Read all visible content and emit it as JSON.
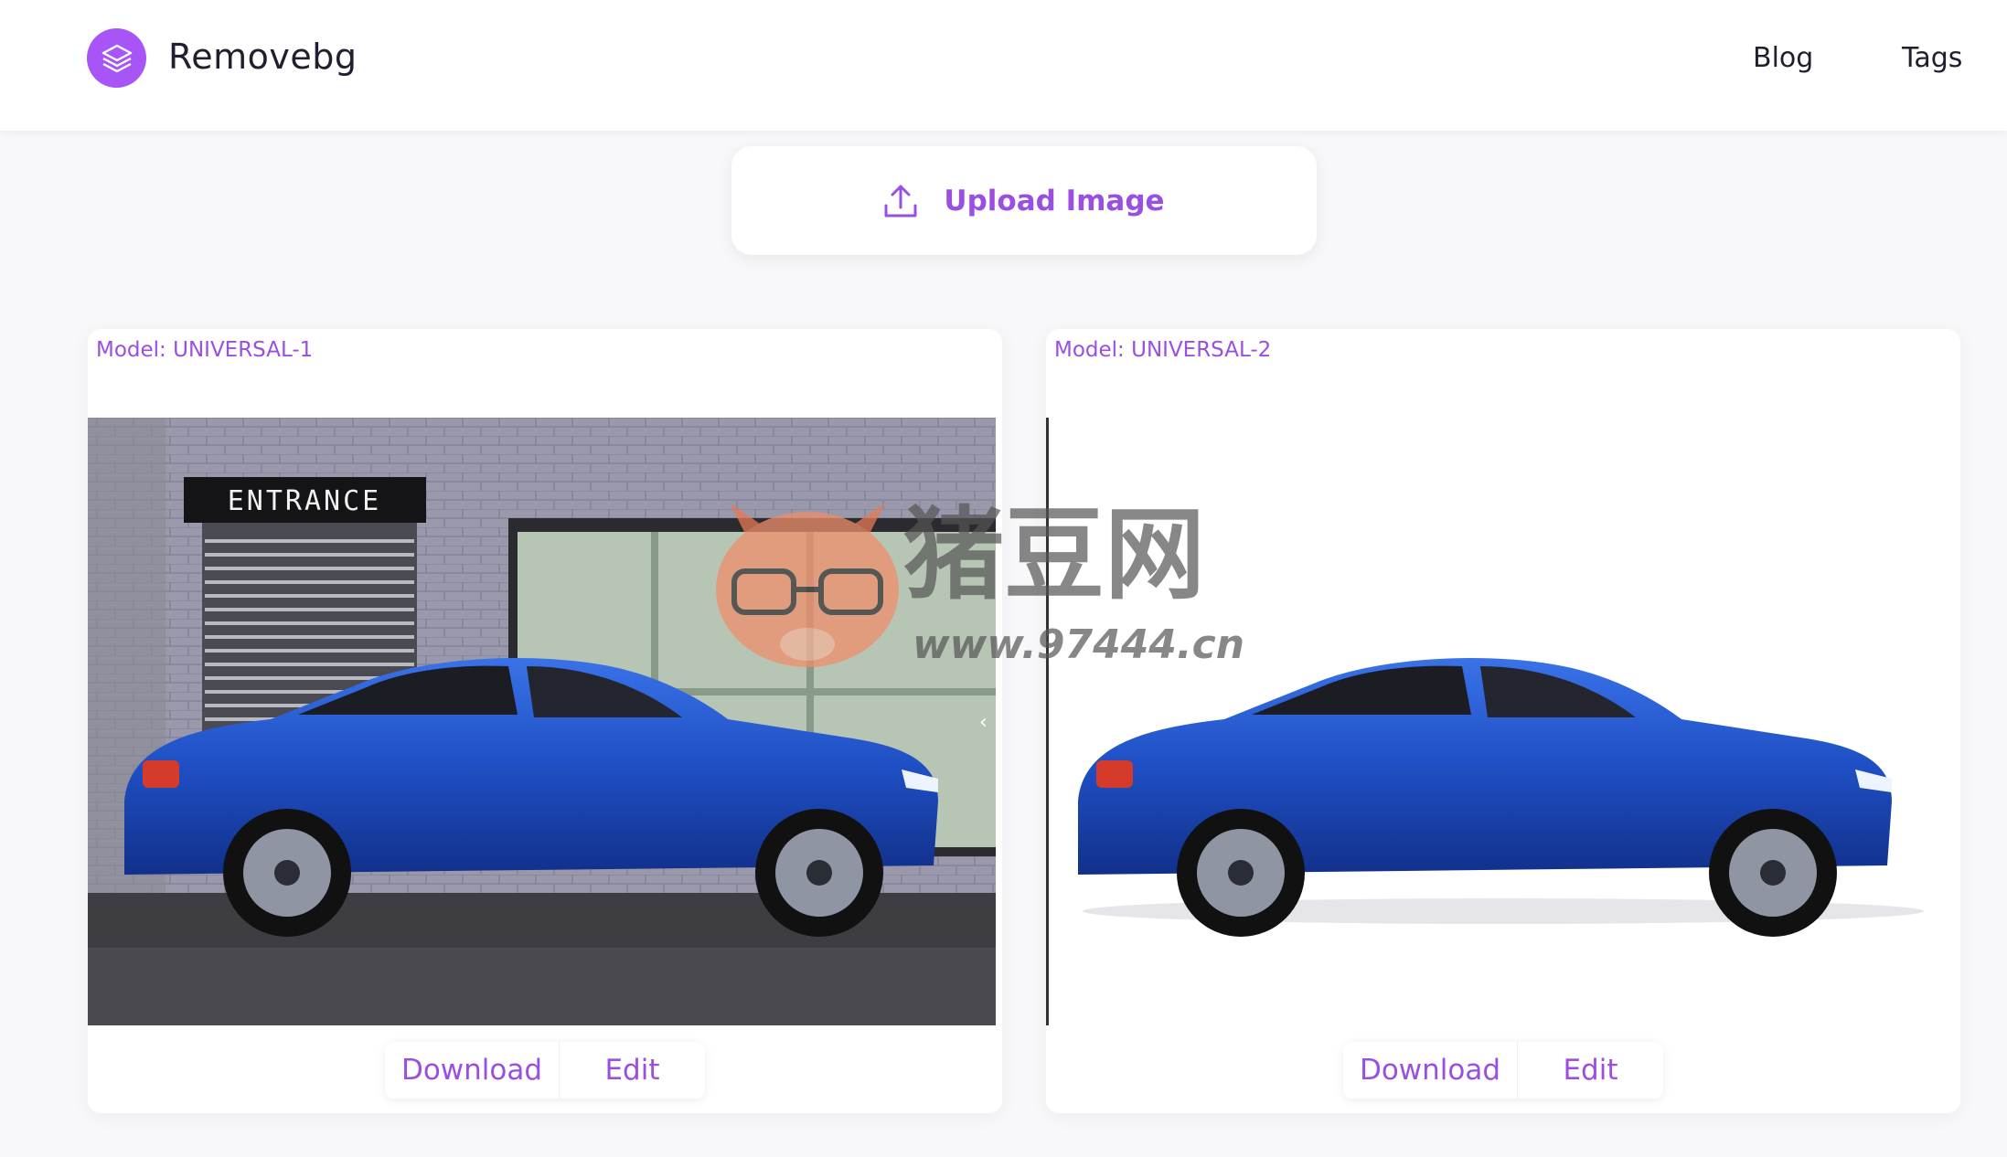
{
  "header": {
    "brand": "Removebg",
    "nav": [
      {
        "label": "Blog"
      },
      {
        "label": "Tags"
      }
    ]
  },
  "upload": {
    "label": "Upload Image",
    "icon": "upload-icon"
  },
  "results": [
    {
      "model": "Model: UNIVERSAL-1",
      "download_label": "Download",
      "edit_label": "Edit",
      "sign_text": "ENTRANCE"
    },
    {
      "model": "Model: UNIVERSAL-2",
      "download_label": "Download",
      "edit_label": "Edit"
    }
  ],
  "watermark": {
    "title": "猪豆网",
    "url": "www.97444.cn"
  },
  "colors": {
    "accent": "#9a4fe0",
    "logo": "#a855f7",
    "car": "#1f4fc4"
  }
}
